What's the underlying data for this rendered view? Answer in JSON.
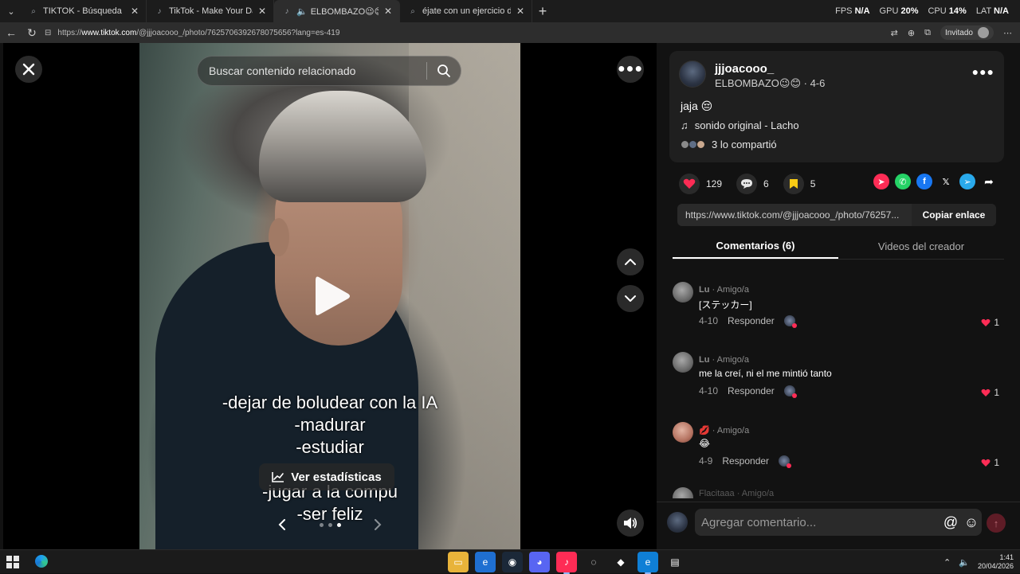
{
  "browser": {
    "tabs": [
      {
        "title": "TIKTOK - Búsqueda",
        "icon": "search-icon",
        "active": false
      },
      {
        "title": "TikTok - Make Your Day",
        "icon": "tiktok-icon",
        "active": false
      },
      {
        "title": "ELBOMBAZO😉😊 (@jjjoaco",
        "icon": "tiktok-icon",
        "active": true
      },
      {
        "title": "éjate con un ejercicio de respiració",
        "icon": "search-icon",
        "active": false
      }
    ],
    "perf": {
      "fps_label": "FPS",
      "fps_value": "N/A",
      "gpu_label": "GPU",
      "gpu_value": "20%",
      "cpu_label": "CPU",
      "cpu_value": "14%",
      "lat_label": "LAT",
      "lat_value": "N/A"
    },
    "url_prefix": "https://",
    "url_host": "www.tiktok.com",
    "url_path": "/@jjjoacooo_/photo/7625706392678075656?lang=es-419",
    "profile_label": "Invitado"
  },
  "viewer": {
    "search_placeholder": "Buscar contenido relacionado",
    "overlay_lines": [
      "-dejar de boludear con la IA",
      "-madurar",
      "-estudiar",
      "-jugar a la compu",
      "-ser feliz"
    ],
    "stats_label": "Ver estadísticas",
    "carousel": {
      "count": 3,
      "active_index": 2
    }
  },
  "post": {
    "author": "jjjoacooo_",
    "nickname": "ELBOMBAZO😉😊",
    "date": "· 4-6",
    "caption": "jaja 😔",
    "sound": "sonido original - Lacho",
    "shared": "3 lo compartió",
    "likes": "129",
    "comments": "6",
    "saves": "5",
    "link": "https://www.tiktok.com/@jjjoacooo_/photo/76257...",
    "copy_label": "Copiar enlace",
    "colors": {
      "like": "#fe2c55",
      "save": "#facc15",
      "accent": "#fe2c55"
    }
  },
  "tabs": {
    "comments_label": "Comentarios (6)",
    "creator_label": "Videos del creador"
  },
  "comments": [
    {
      "name": "Lu",
      "tag": "· Amigo/a",
      "text": "[ステッカー]",
      "date": "4-10",
      "reply": "Responder",
      "likes": "1",
      "avatar": "gray"
    },
    {
      "name": "Lu",
      "tag": "· Amigo/a",
      "text": "me la creí, ni el me mintió tanto",
      "date": "4-10",
      "reply": "Responder",
      "likes": "1",
      "avatar": "gray"
    },
    {
      "name": "💋",
      "tag": "· Amigo/a",
      "text": "😂",
      "date": "4-9",
      "reply": "Responder",
      "likes": "1",
      "avatar": "pink"
    }
  ],
  "peek_comment": "Flacitaaa · Amigo/a",
  "composer": {
    "placeholder": "Agregar comentario..."
  },
  "taskbar": {
    "time": "1:41",
    "date": "20/04/2026"
  }
}
